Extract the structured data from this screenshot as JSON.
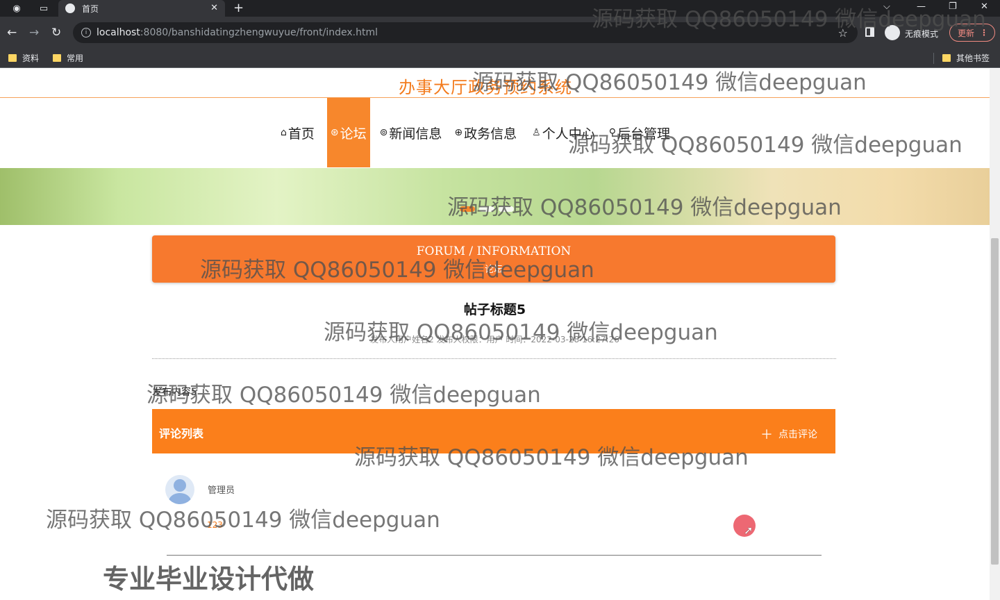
{
  "browser": {
    "tab_title": "首页",
    "url_host": "localhost",
    "url_path": ":8080/banshidatingzhengwuyue/front/index.html",
    "incognito_label": "无痕模式",
    "update_label": "更新",
    "bookmarks": [
      "资料",
      "常用"
    ],
    "other_bookmarks": "其他书签"
  },
  "site": {
    "title": "办事大厅政务预约系统",
    "nav": [
      {
        "icon": "⌂",
        "label": "首页"
      },
      {
        "icon": "⊛",
        "label": "论坛"
      },
      {
        "icon": "⊚",
        "label": "新闻信息"
      },
      {
        "icon": "⊕",
        "label": "政务信息"
      },
      {
        "icon": "♙",
        "label": "个人中心"
      },
      {
        "icon": "⚲",
        "label": "后台管理"
      }
    ],
    "active_nav": "论坛"
  },
  "forum_header": {
    "english": "FORUM / INFORMATION",
    "chinese": "论坛"
  },
  "post": {
    "title": "帖子标题5",
    "meta": "发布人用户姓名2  发布人权限：用户  时间：2022-03-28 16:27:26",
    "content": "发布内容5"
  },
  "comments": {
    "header": "评论列表",
    "add_label": "点击评论",
    "items": [
      {
        "user": "管理员",
        "text": "123"
      }
    ]
  },
  "watermarks": [
    "源码获取 QQ86050149 微信deepguan",
    "专业毕业设计代做"
  ],
  "colors": {
    "accent": "#f7872c",
    "comment_bar": "#fb7f1b",
    "title": "#f37b1d"
  }
}
